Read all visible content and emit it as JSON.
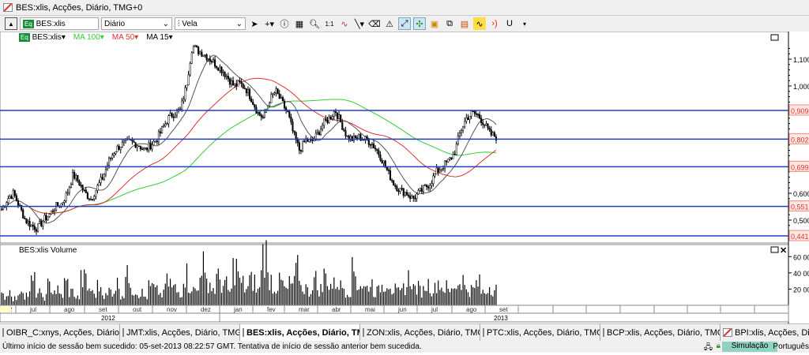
{
  "window": {
    "title": "BES:xlis, Acções, Diário, TMG+0"
  },
  "toolbar": {
    "symbol": "BES:xlis",
    "symbol_badge": "Eq",
    "period": "Diário",
    "chart_type": "Vela"
  },
  "legend": {
    "symbol": "BES:xlis",
    "ma100": "MA 100",
    "ma50": "MA 50",
    "ma15": "MA 15"
  },
  "colors": {
    "ma100": "#33cc33",
    "ma50": "#e03030",
    "ma15": "#555555",
    "hline": "#1f3fbf",
    "label": "#e03030"
  },
  "price_axis": {
    "ticks": [
      "1,100",
      "1,000",
      "0,600",
      "0,500"
    ],
    "tick_values": [
      1.1,
      1.0,
      0.6,
      0.5
    ]
  },
  "hlines": [
    {
      "value": 0.909,
      "label": "0,909"
    },
    {
      "value": 0.802,
      "label": "0,802"
    },
    {
      "value": 0.699,
      "label": "0,699"
    },
    {
      "value": 0.551,
      "label": "0,551"
    },
    {
      "value": 0.441,
      "label": "0,441"
    }
  ],
  "volume": {
    "title": "BES:xlis Volume",
    "ticks": [
      "60 00",
      "40 00",
      "20 00"
    ],
    "tick_values": [
      60000,
      40000,
      20000
    ],
    "values": [
      12,
      18,
      9,
      22,
      14,
      30,
      16,
      11,
      25,
      19,
      13,
      28,
      17,
      10,
      33,
      21,
      15,
      24,
      12,
      19,
      27,
      14,
      36,
      20,
      16,
      11,
      23,
      18,
      14,
      29,
      22,
      17,
      40,
      25,
      19,
      55,
      30,
      21,
      34,
      26,
      18,
      48,
      28,
      22,
      31,
      19,
      66,
      35,
      24,
      29,
      20,
      27,
      45,
      23,
      18,
      33,
      21,
      38,
      26,
      30,
      24,
      19,
      43,
      27,
      22,
      28,
      18,
      25,
      31,
      20,
      16,
      24,
      35,
      22,
      19,
      27,
      21,
      30,
      23,
      18,
      26,
      34,
      22,
      20,
      28,
      17,
      25,
      21
    ]
  },
  "price_series": [
    0.54,
    0.58,
    0.6,
    0.55,
    0.5,
    0.48,
    0.47,
    0.5,
    0.52,
    0.55,
    0.56,
    0.6,
    0.67,
    0.64,
    0.6,
    0.58,
    0.62,
    0.66,
    0.72,
    0.76,
    0.78,
    0.79,
    0.79,
    0.78,
    0.76,
    0.78,
    0.8,
    0.84,
    0.88,
    0.9,
    0.91,
    1.0,
    1.15,
    1.13,
    1.12,
    1.1,
    1.08,
    1.06,
    1.03,
    1.0,
    1.01,
    0.99,
    0.95,
    0.9,
    0.88,
    0.95,
    0.98,
    0.94,
    0.9,
    0.82,
    0.76,
    0.8,
    0.79,
    0.82,
    0.86,
    0.88,
    0.91,
    0.86,
    0.81,
    0.8,
    0.81,
    0.8,
    0.79,
    0.76,
    0.72,
    0.67,
    0.63,
    0.61,
    0.6,
    0.58,
    0.6,
    0.62,
    0.64,
    0.68,
    0.7,
    0.72,
    0.75,
    0.83,
    0.88,
    0.9,
    0.89,
    0.86,
    0.82,
    0.81
  ],
  "time_axis": {
    "months": [
      "012",
      "jul",
      "ago",
      "set",
      "out",
      "nov",
      "dez",
      "jan",
      "fev",
      "mar",
      "abr",
      "mai",
      "jun",
      "jul",
      "ago",
      "set"
    ],
    "years": [
      "2012",
      "2013"
    ]
  },
  "tabs": [
    {
      "label": "OIBR_C:xnys, Acções, Diário, ..."
    },
    {
      "label": "JMT:xlis, Acções, Diário, TMG..."
    },
    {
      "label": "BES:xlis, Acções, Diário, TM...",
      "active": true
    },
    {
      "label": "ZON:xlis, Acções, Diário, TMG..."
    },
    {
      "label": "PTC:xlis, Acções, Diário, TMG..."
    },
    {
      "label": "BCP:xlis, Acções, Diário, TMG..."
    },
    {
      "label": "BPI:xlis, Acções, Diário"
    }
  ],
  "status": {
    "message": "Último início de sessão bem sucedido: 05-set-2013 08:22:57 GMT. Tentativa de início de sessão anterior bem sucedida.",
    "mode": "Simulação",
    "language": "Português"
  }
}
